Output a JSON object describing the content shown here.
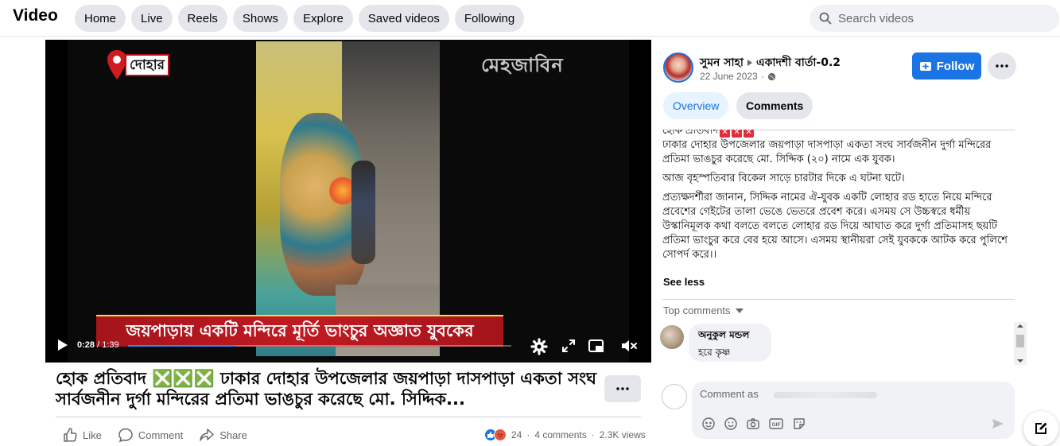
{
  "header": {
    "title": "Video",
    "nav": [
      "Home",
      "Live",
      "Reels",
      "Shows",
      "Explore",
      "Saved videos",
      "Following"
    ],
    "search_placeholder": "Search videos"
  },
  "video": {
    "location_label": "দোহার",
    "channel_logo_text": "মেহজাবিন",
    "ticker": "জয়পাড়ায় একটি মন্দিরে মূর্তি ভাংচুর অজ্ঞাত যুবকের",
    "current_time": "0:28",
    "duration": "1:39",
    "progress": 0.2828
  },
  "post": {
    "title": "হোক প্রতিবাদ ❎❎❎ ঢাকার দোহার উপজেলার জয়পাড়া দাসপাড়া একতা সংঘ সার্বজনীন দুর্গা মন্দিরের প্রতিমা ভাঙচুর করেছে মো. সিদ্দিক...",
    "actions": {
      "like": "Like",
      "comment": "Comment",
      "share": "Share"
    },
    "stats": {
      "reactions": "24",
      "comments": "4 comments",
      "views": "2.3K views"
    }
  },
  "panel": {
    "author": "সুমন সাহা",
    "page": "একাদশী বার্তা-0.2",
    "date": "22 June 2023",
    "follow_label": "Follow",
    "tabs": [
      "Overview",
      "Comments"
    ],
    "description": {
      "line0": "হোক প্রতিবাদ",
      "p1": "ঢাকার দোহার উপজেলার জয়পাড়া দাসপাড়া একতা সংঘ সার্বজনীন দুর্গা মন্দিরের প্রতিমা ভাঙচুর করেছে মো. সিদ্দিক (২০) নামে এক যুবক।",
      "p2": "আজ বৃহস্পতিবার বিকেল সাড়ে চারটার দিকে এ ঘটনা ঘটে।",
      "p3": "প্রত্যক্ষদর্শীরা জানান, সিদ্দিক নামের ঐ-যুবক একটি লোহার রড হাতে নিয়ে মন্দিরে প্রবেশের গেইটের তালা ভেঙে ভেতরে প্রবেশ করে। এসময় সে উচ্চস্বরে ধর্মীয় উস্কানিমূলক কথা বলতে বলতে লোহার রড দিয়ে আঘাত করে দুর্গা প্রতিমাসহ ছয়টি প্রতিমা ভাংচুর করে বের হয়ে আসে। এসময় স্থানীয়রা সেই যুবককে আটক করে পুলিশে সোপর্দ করে।।"
    },
    "see_less": "See less",
    "top_comments": "Top comments",
    "comment": {
      "name": "অনুকুল মন্ডল",
      "text": "হরে কৃষ্ণ"
    },
    "comment_placeholder": "Comment as"
  },
  "colors": {
    "accent": "#1b74e4",
    "pill_bg": "#e4e6eb",
    "ticker_red": "#c11a22"
  }
}
